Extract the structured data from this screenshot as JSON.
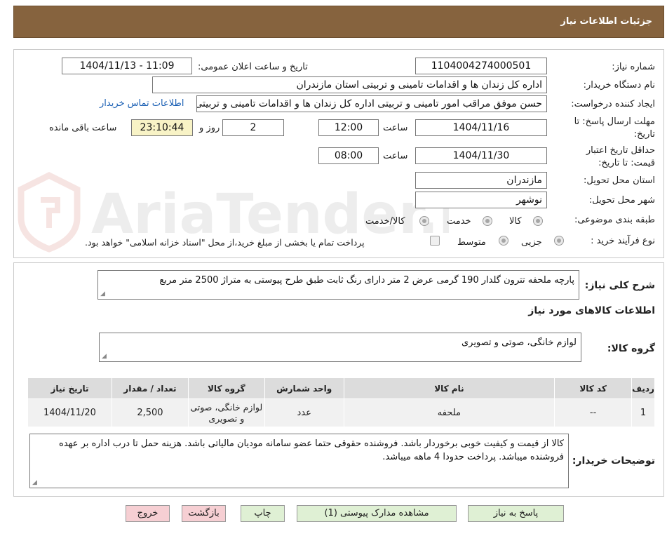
{
  "header": {
    "title": "جزئیات اطلاعات نیاز"
  },
  "watermark": {
    "text": "AriaTender.neT"
  },
  "form": {
    "need_number": {
      "label": "شماره نیاز:",
      "value": "1104004274000501"
    },
    "announce": {
      "label": "تاریخ و ساعت اعلان عمومی:",
      "value": "1404/11/13 - 11:09"
    },
    "buyer_org": {
      "label": "نام دستگاه خریدار:",
      "value": "اداره کل زندان ها و اقدامات تامینی و تربیتی استان مازندران"
    },
    "requester": {
      "label": "ایجاد کننده درخواست:",
      "value": "حسن موفق مراقب امور تامینی و تربیتی اداره کل زندان ها و اقدامات تامینی و تربیتی استان مازندران"
    },
    "buyer_contact_link": "اطلاعات تماس خریدار",
    "reply_deadline": {
      "label_line1": "مهلت ارسال پاسخ: تا",
      "label_line2": "تاریخ:",
      "date": "1404/11/16",
      "time_label": "ساعت",
      "time": "12:00",
      "days": "2",
      "days_label": "روز و",
      "remaining": "23:10:44",
      "remaining_label": "ساعت باقی مانده"
    },
    "price_validity": {
      "label_line1": "حداقل تاریخ اعتبار",
      "label_line2": "قیمت: تا تاریخ:",
      "date": "1404/11/30",
      "time_label": "ساعت",
      "time": "08:00"
    },
    "province": {
      "label": "استان محل تحویل:",
      "value": "مازندران"
    },
    "city": {
      "label": "شهر محل تحویل:",
      "value": "نوشهر"
    },
    "category": {
      "label": "طبقه بندی موضوعی:",
      "options": [
        "کالا",
        "خدمت",
        "کالا/خدمت"
      ]
    },
    "process": {
      "label": "نوع فرآیند خرید :",
      "options": [
        "جزیی",
        "متوسط"
      ],
      "note": "پرداخت تمام یا بخشی از مبلغ خرید،از محل \"اسناد خزانه اسلامی\" خواهد بود."
    }
  },
  "summary": {
    "label": "شرح کلی نیاز:",
    "value": "پارچه ملحفه تترون گلدار 190 گرمی عرض 2 متر دارای رنگ ثابت طبق طرح پیوستی به متراژ 2500 متر مربع"
  },
  "goods_section": {
    "title": "اطلاعات کالاهای مورد نیاز"
  },
  "goods_group": {
    "label": "گروه کالا:",
    "value": "لوازم خانگی، صوتی و تصویری"
  },
  "table": {
    "headers": [
      "ردیف",
      "کد کالا",
      "نام کالا",
      "واحد شمارش",
      "گروه کالا",
      "تعداد / مقدار",
      "تاریخ نیاز"
    ],
    "rows": [
      [
        "1",
        "--",
        "ملحفه",
        "عدد",
        "لوازم خانگی، صوتی و تصویری",
        "2,500",
        "1404/11/20"
      ]
    ]
  },
  "buyer_notes": {
    "label": "توضیحات خریدار:",
    "value": "کالا از قیمت و کیفیت خوبی برخوردار باشد. فروشنده حقوقی حتما عضو سامانه مودیان مالیاتی باشد. هزینه حمل تا درب اداره بر عهده فروشنده میباشد. پرداخت حدودا 4 ماهه میباشد."
  },
  "buttons": {
    "reply": "پاسخ به نیاز",
    "attachments": "مشاهده مدارک پیوستی (1)",
    "print": "چاپ",
    "back": "بازگشت",
    "exit": "خروج"
  }
}
